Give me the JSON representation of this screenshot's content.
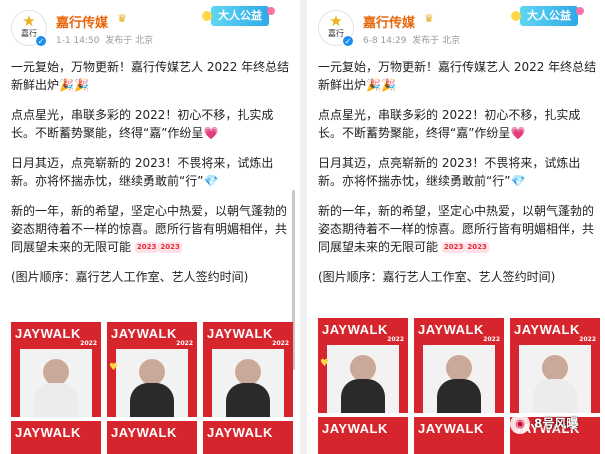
{
  "left_post": {
    "account_name": "嘉行传媒",
    "avatar_text": "嘉行",
    "date": "1-1 14:50",
    "source": "发布于 北京",
    "badge": "大人公益",
    "paragraphs": {
      "p1": "一元复始，万物更新！嘉行传媒艺人 2022 年终总结新鲜出炉",
      "p2": "点点星光，串联多彩的 2022！初心不移，扎实成长。不断蓄势聚能，终得“嘉”作纷呈",
      "p3": "日月其迈，点亮崭新的 2023！不畏将来，试炼出新。亦将怀揣赤忱，继续勇敢前“行”",
      "p4": "新的一年，新的希望，坚定心中热爱，以朝气蓬勃的姿态期待着不一样的惊喜。愿所行皆有明媚相伴，共同展望未来的无限可能",
      "p5": "(图片顺序：嘉行艺人工作室、艺人签约时间)"
    },
    "tiles": [
      "JAYWALK",
      "JAYWALK",
      "JAYWALK",
      "JAYWALK",
      "JAYWALK",
      "JAYWALK"
    ],
    "tile_year": "2022"
  },
  "right_post": {
    "account_name": "嘉行传媒",
    "avatar_text": "嘉行",
    "date": "6-8 14:29",
    "source": "发布于 北京",
    "badge": "大人公益",
    "paragraphs": {
      "p1": "一元复始，万物更新！嘉行传媒艺人 2022 年终总结新鲜出炉",
      "p2": "点点星光，串联多彩的 2022！初心不移，扎实成长。不断蓄势聚能，终得“嘉”作纷呈",
      "p3": "日月其迈，点亮崭新的 2023！不畏将来，试炼出新。亦将怀揣赤忱，继续勇敢前“行”",
      "p4": "新的一年，新的希望，坚定心中热爱，以朝气蓬勃的姿态期待着不一样的惊喜。愿所行皆有明媚相伴，共同展望未来的无限可能",
      "p5": "(图片顺序：嘉行艺人工作室、艺人签约时间)"
    },
    "tiles": [
      "JAYWALK",
      "JAYWALK",
      "JAYWALK",
      "JAYWALK",
      "JAYWALK",
      "JAYWALK"
    ],
    "tile_year": "2022"
  },
  "emoji": {
    "party": "🎉",
    "heart": "💗",
    "gem": "💎",
    "tag2023": "2023"
  },
  "watermark": {
    "text": "8号风曝"
  },
  "colors": {
    "account_name": "#e8660b",
    "tile_red": "#d6252d",
    "verify_blue": "#1a8ff0"
  }
}
